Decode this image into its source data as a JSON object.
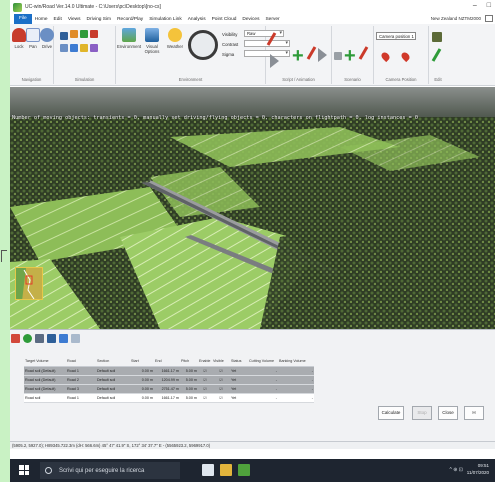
{
  "window": {
    "title": "UC-win/Road Ver.14.0 Ultimate - C:\\Users\\pc\\Desktop\\[no-cs]",
    "controls": [
      "–",
      "□"
    ]
  },
  "menubar": {
    "items": [
      "File",
      "Home",
      "Edit",
      "Views",
      "Driving Sim",
      "Record/Play",
      "Simulation Link",
      "Analysis",
      "Point Cloud",
      "Devices",
      "Server"
    ],
    "right_text": "New Zealand  NZTM2000"
  },
  "ribbon": {
    "navigation": {
      "caption": "Navigation",
      "buttons": [
        "Lock",
        "Pan",
        "Drive"
      ]
    },
    "simulation": {
      "caption": "Simulation"
    },
    "environment": {
      "caption": "Environment",
      "buttons": [
        "Environment",
        "Visual Options",
        "Weather"
      ],
      "rows": [
        {
          "label": "Visibility",
          "value": "Raw"
        },
        {
          "label": "Contrast",
          "value": ""
        },
        {
          "label": "Sigma",
          "value": ""
        }
      ]
    },
    "script": {
      "caption": "Script / Animation"
    },
    "scenario": {
      "caption": "Scenario"
    },
    "camera": {
      "caption": "Camera Position",
      "select": "Camera position 1"
    },
    "edit": {
      "caption": "Edit"
    }
  },
  "viewport": {
    "overlay": "Number of moving objects: transients = 0, manually set driving/flying objects = 0, characters on flightpath = 0, log instances = 0"
  },
  "table": {
    "columns": [
      "Target Volume",
      "Road",
      "Section",
      "Start",
      "End",
      "Pitch",
      "Enable",
      "Visible",
      "Status",
      "Cutting Volume",
      "Banking Volume"
    ],
    "rows": [
      {
        "target": "Road soil (Default)",
        "road": "Road 1",
        "section": "Default soil",
        "start": "0.00 m",
        "end": "1661.17 m",
        "pitch": "5.00 m",
        "enable": "☑",
        "visible": "☑",
        "status": "Yet",
        "cutting": "-",
        "banking": "-",
        "selected": true
      },
      {
        "target": "Road soil (Default)",
        "road": "Road 2",
        "section": "Default soil",
        "start": "0.00 m",
        "end": "1204.99 m",
        "pitch": "5.00 m",
        "enable": "☑",
        "visible": "☑",
        "status": "Yet",
        "cutting": "-",
        "banking": "-",
        "selected": true
      },
      {
        "target": "Road soil (Default)",
        "road": "Road 3",
        "section": "Default soil",
        "start": "0.00 m",
        "end": "2751.47 m",
        "pitch": "5.00 m",
        "enable": "☑",
        "visible": "☑",
        "status": "Yet",
        "cutting": "-",
        "banking": "-",
        "selected": true
      },
      {
        "target": "Road soil",
        "road": "Road 1",
        "section": "Default soil",
        "start": "0.00 m",
        "end": "1661.17 m",
        "pitch": "5.00 m",
        "enable": "☑",
        "visible": "☑",
        "status": "Yet",
        "cutting": "-",
        "banking": "-",
        "selected": false
      }
    ]
  },
  "buttons": {
    "calculate": "Calculate",
    "stop": "Stop",
    "close": "Close",
    "help": "H"
  },
  "statusbar": {
    "text": "(5905.2, 5927.0); H89345.722.3m (dH: 566.6m)    45° 47' 41.9\" S, 172° 34' 37.7\" E  -  (5565923.2, 5969917.0)"
  },
  "taskbar": {
    "search_placeholder": "Scrivi qui per eseguire la ricerca",
    "time": "09:51",
    "date": "11/07/2020",
    "tray": "^  ⊕  ⊡"
  },
  "colors": {
    "ribbon_file": "#1b6fc7",
    "terrain_dark": "#2f3c25",
    "terrain_field": "#8dbd58",
    "road": "#6a6d70",
    "taskbar": "#1e2530"
  }
}
